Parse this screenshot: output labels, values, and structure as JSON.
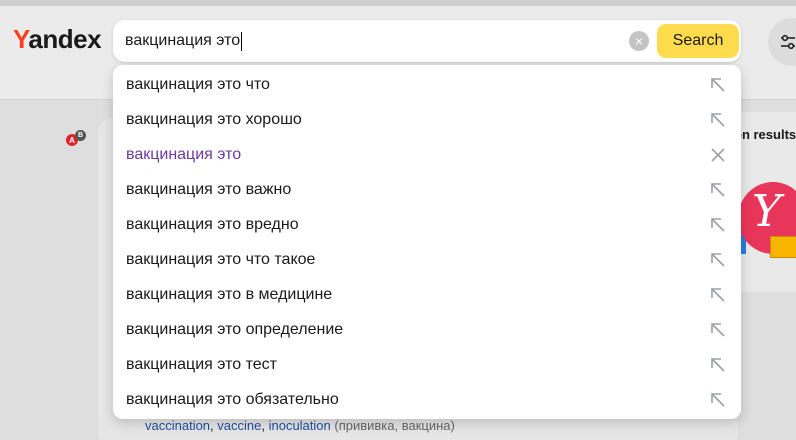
{
  "brand": {
    "logo_first": "Y",
    "logo_rest": "andex"
  },
  "search": {
    "query": "вакцинация это",
    "button_label": "Search",
    "clear_glyph": "×"
  },
  "suggestions": [
    {
      "text": "вакцинация это что",
      "visited": false,
      "action_icon": "arrow-up-left-icon"
    },
    {
      "text": "вакцинация это хорошо",
      "visited": false,
      "action_icon": "arrow-up-left-icon"
    },
    {
      "text": "вакцинация это",
      "visited": true,
      "action_icon": "close-icon"
    },
    {
      "text": "вакцинация это важно",
      "visited": false,
      "action_icon": "arrow-up-left-icon"
    },
    {
      "text": "вакцинация это вредно",
      "visited": false,
      "action_icon": "arrow-up-left-icon"
    },
    {
      "text": "вакцинация это что такое",
      "visited": false,
      "action_icon": "arrow-up-left-icon"
    },
    {
      "text": "вакцинация это в медицине",
      "visited": false,
      "action_icon": "arrow-up-left-icon"
    },
    {
      "text": "вакцинация это определение",
      "visited": false,
      "action_icon": "arrow-up-left-icon"
    },
    {
      "text": "вакцинация это тест",
      "visited": false,
      "action_icon": "arrow-up-left-icon"
    },
    {
      "text": "вакцинация это обязательно",
      "visited": false,
      "action_icon": "arrow-up-left-icon"
    }
  ],
  "right_panel": {
    "label": "on results"
  },
  "translation": {
    "words": [
      "vaccination",
      "vaccine",
      "inoculation"
    ],
    "separator_1": ", ",
    "separator_2": ", ",
    "note": " (прививка, вакцина)"
  },
  "badges": {
    "a": "A",
    "b": "B"
  },
  "colors": {
    "accent_button": "#ffdb4d",
    "logo_red": "#fc3f1d",
    "visited_link": "#6a3a9e",
    "link": "#1f4fa0"
  }
}
